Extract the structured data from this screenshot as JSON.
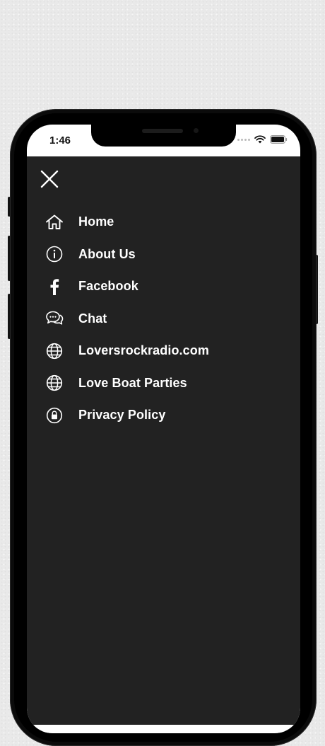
{
  "status_bar": {
    "time": "1:46"
  },
  "drawer": {
    "close_icon": "close-icon",
    "items": [
      {
        "label": "Home",
        "icon": "home-icon"
      },
      {
        "label": "About Us",
        "icon": "info-icon"
      },
      {
        "label": "Facebook",
        "icon": "facebook-icon"
      },
      {
        "label": "Chat",
        "icon": "chat-icon"
      },
      {
        "label": "Loversrockradio.com",
        "icon": "globe-icon"
      },
      {
        "label": "Love Boat Parties",
        "icon": "globe-icon"
      },
      {
        "label": "Privacy Policy",
        "icon": "lock-icon"
      }
    ]
  },
  "colors": {
    "drawer_bg": "#222222",
    "text": "#ffffff",
    "phone": "#0b0b0b"
  }
}
